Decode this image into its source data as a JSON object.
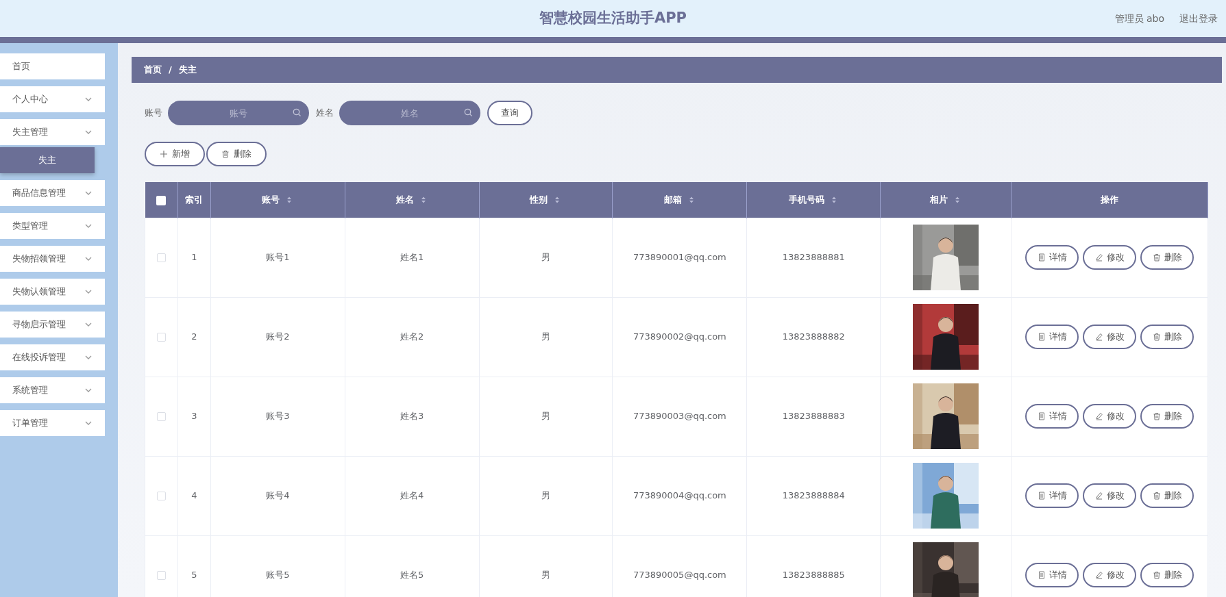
{
  "header": {
    "title": "智慧校园生活助手APP",
    "user_label": "管理员 abo",
    "logout": "退出登录"
  },
  "sidebar": {
    "items": [
      {
        "label": "首页",
        "kind": "link",
        "selected": false
      },
      {
        "label": "个人中心",
        "kind": "menu",
        "selected": false
      },
      {
        "label": "失主管理",
        "kind": "menu",
        "expanded": true,
        "selected": false,
        "children": [
          {
            "label": "失主",
            "selected": true
          }
        ]
      },
      {
        "label": "商品信息管理",
        "kind": "menu",
        "selected": false
      },
      {
        "label": "类型管理",
        "kind": "menu",
        "selected": false
      },
      {
        "label": "失物招领管理",
        "kind": "menu",
        "selected": false
      },
      {
        "label": "失物认领管理",
        "kind": "menu",
        "selected": false
      },
      {
        "label": "寻物启示管理",
        "kind": "menu",
        "selected": false
      },
      {
        "label": "在线投诉管理",
        "kind": "menu",
        "selected": false
      },
      {
        "label": "系统管理",
        "kind": "menu",
        "selected": false
      },
      {
        "label": "订单管理",
        "kind": "menu",
        "selected": false
      }
    ]
  },
  "breadcrumb": {
    "items": [
      "首页",
      "失主"
    ],
    "separator": "/"
  },
  "search": {
    "fields": [
      {
        "label": "账号",
        "placeholder": "账号"
      },
      {
        "label": "姓名",
        "placeholder": "姓名"
      }
    ],
    "button": "查询"
  },
  "actions": [
    {
      "kind": "add",
      "label": "新增"
    },
    {
      "kind": "delete",
      "label": "删除"
    }
  ],
  "table": {
    "select_all": {
      "checked": false
    },
    "columns": [
      {
        "label": "索引",
        "sortable": false
      },
      {
        "label": "账号",
        "sortable": true
      },
      {
        "label": "姓名",
        "sortable": true
      },
      {
        "label": "性别",
        "sortable": true
      },
      {
        "label": "邮箱",
        "sortable": true
      },
      {
        "label": "手机号码",
        "sortable": true
      },
      {
        "label": "相片",
        "sortable": true
      },
      {
        "label": "操作",
        "sortable": false
      }
    ],
    "rows": [
      {
        "checked": false,
        "cells": [
          "1",
          "账号1",
          "姓名1",
          "男",
          "773890001@qq.com",
          "13823888881"
        ],
        "actions": [
          {
            "kind": "detail",
            "label": "详情"
          },
          {
            "kind": "edit",
            "label": "修改"
          },
          {
            "kind": "delete",
            "label": "删除"
          }
        ]
      },
      {
        "checked": false,
        "cells": [
          "2",
          "账号2",
          "姓名2",
          "男",
          "773890002@qq.com",
          "13823888882"
        ],
        "actions": [
          {
            "kind": "detail",
            "label": "详情"
          },
          {
            "kind": "edit",
            "label": "修改"
          },
          {
            "kind": "delete",
            "label": "删除"
          }
        ]
      },
      {
        "checked": false,
        "cells": [
          "3",
          "账号3",
          "姓名3",
          "男",
          "773890003@qq.com",
          "13823888883"
        ],
        "actions": [
          {
            "kind": "detail",
            "label": "详情"
          },
          {
            "kind": "edit",
            "label": "修改"
          },
          {
            "kind": "delete",
            "label": "删除"
          }
        ]
      },
      {
        "checked": false,
        "cells": [
          "4",
          "账号4",
          "姓名4",
          "男",
          "773890004@qq.com",
          "13823888884"
        ],
        "actions": [
          {
            "kind": "detail",
            "label": "详情"
          },
          {
            "kind": "edit",
            "label": "修改"
          },
          {
            "kind": "delete",
            "label": "删除"
          }
        ]
      },
      {
        "checked": false,
        "cells": [
          "5",
          "账号5",
          "姓名5",
          "男",
          "773890005@qq.com",
          "13823888885"
        ],
        "actions": [
          {
            "kind": "detail",
            "label": "详情"
          },
          {
            "kind": "edit",
            "label": "修改"
          },
          {
            "kind": "delete",
            "label": "删除"
          }
        ]
      }
    ]
  }
}
